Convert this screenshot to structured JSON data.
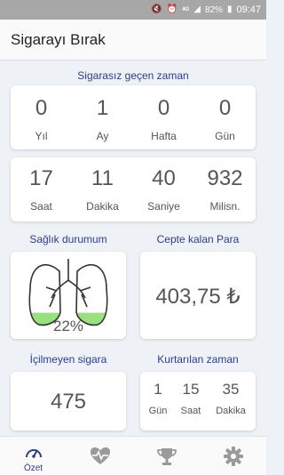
{
  "status": {
    "network": "4G",
    "signal_label": "4G",
    "battery": "82%",
    "time": "09:47"
  },
  "appbar": {
    "title": "Sigarayı Bırak"
  },
  "elapsed": {
    "title": "Sigarasız geçen zaman",
    "row1": [
      {
        "value": "0",
        "label": "Yıl"
      },
      {
        "value": "1",
        "label": "Ay"
      },
      {
        "value": "0",
        "label": "Hafta"
      },
      {
        "value": "0",
        "label": "Gün"
      }
    ],
    "row2": [
      {
        "value": "17",
        "label": "Saat"
      },
      {
        "value": "11",
        "label": "Dakika"
      },
      {
        "value": "40",
        "label": "Saniye"
      },
      {
        "value": "932",
        "label": "Milisn."
      }
    ]
  },
  "health": {
    "title": "Sağlık durumum",
    "percent": "22%",
    "fill_fraction": 0.22,
    "icon": "lungs-icon"
  },
  "money": {
    "title": "Cepte kalan Para",
    "value": "403,75 ₺"
  },
  "cigarettes": {
    "title": "İçilmeyen sigara",
    "value": "475"
  },
  "saved_time": {
    "title": "Kurtarılan zaman",
    "items": [
      {
        "value": "1",
        "label": "Gün"
      },
      {
        "value": "15",
        "label": "Saat"
      },
      {
        "value": "35",
        "label": "Dakika"
      }
    ]
  },
  "nav": {
    "items": [
      {
        "label": "Özet",
        "icon": "speedometer-icon",
        "active": true
      },
      {
        "label": "",
        "icon": "heart-pulse-icon",
        "active": false
      },
      {
        "label": "",
        "icon": "trophy-icon",
        "active": false
      },
      {
        "label": "",
        "icon": "gear-icon",
        "active": false
      }
    ]
  },
  "colors": {
    "accent": "#2e3d8e",
    "lung_fill": "#9be07e",
    "status_bar": "#a7a7a7"
  }
}
